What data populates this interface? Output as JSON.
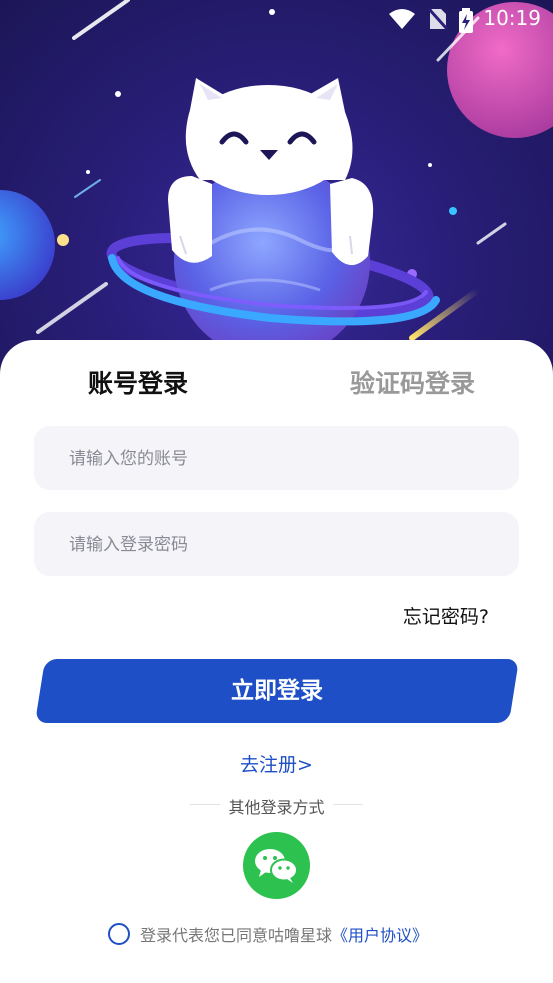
{
  "status_bar": {
    "time": "10:19",
    "icons": [
      "wifi-icon",
      "no-sim-icon",
      "battery-charging-icon"
    ]
  },
  "hero": {
    "illustration": "cat-hugging-planet"
  },
  "tabs": [
    {
      "label": "账号登录",
      "active": true
    },
    {
      "label": "验证码登录",
      "active": false
    }
  ],
  "form": {
    "account_placeholder": "请输入您的账号",
    "password_placeholder": "请输入登录密码",
    "forgot_label": "忘记密码?",
    "login_button": "立即登录",
    "register_link": "去注册>"
  },
  "other_login": {
    "label": "其他登录方式",
    "icon": "wechat-icon"
  },
  "agreement": {
    "text": "登录代表您已同意咕噜星球",
    "link": "《用户协议》",
    "checked": false
  },
  "colors": {
    "primary": "#1f4fc6",
    "wechat": "#2dc24f",
    "hero_bg": "#2a1f7c",
    "field_bg": "#f4f4f9"
  }
}
